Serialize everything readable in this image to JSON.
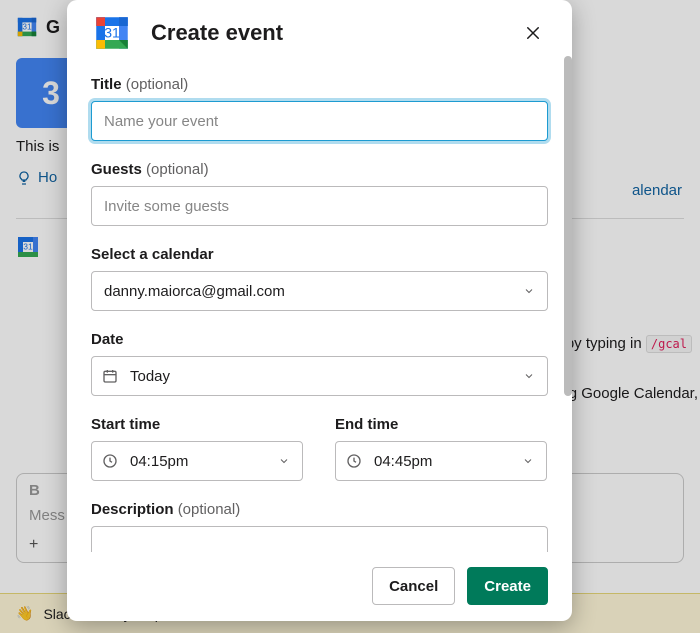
{
  "modal": {
    "title": "Create event",
    "fields": {
      "title": {
        "label": "Title",
        "optional": "(optional)",
        "placeholder": "Name your event"
      },
      "guests": {
        "label": "Guests",
        "optional": "(optional)",
        "placeholder": "Invite some guests"
      },
      "calendar": {
        "label": "Select a calendar",
        "value": "danny.maiorca@gmail.com"
      },
      "date": {
        "label": "Date",
        "value": "Today"
      },
      "start_time": {
        "label": "Start time",
        "value": "04:15pm"
      },
      "end_time": {
        "label": "End time",
        "value": "04:45pm"
      },
      "description": {
        "label": "Description",
        "optional": "(optional)"
      }
    },
    "footer": {
      "cancel": "Cancel",
      "create": "Create"
    }
  },
  "background": {
    "top_title": "G",
    "text1_left": "This is",
    "text1_right": "alendar",
    "tip": "Ho",
    "msg_right_1": "by typing in",
    "msg_code": "/gcal",
    "msg_right_2": "g Google Calendar,",
    "composer_bold": "B",
    "composer_msg": "Mess",
    "composer_plus": "+",
    "banner_text": "Slack needs your permission to enable notifications. Enable notifications"
  }
}
